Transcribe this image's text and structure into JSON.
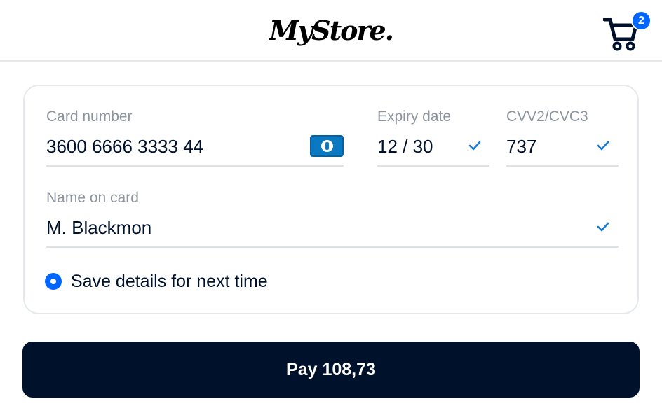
{
  "header": {
    "logo_text": "MyStore.",
    "cart_count": "2"
  },
  "form": {
    "card_number": {
      "label": "Card number",
      "value": "3600 6666 3333 44",
      "brand_icon": "diners-club-icon"
    },
    "expiry": {
      "label": "Expiry date",
      "value": "12 / 30"
    },
    "cvv": {
      "label": "CVV2/CVC3",
      "value": "737"
    },
    "name": {
      "label": "Name on card",
      "value": "M. Blackmon"
    },
    "save_details": {
      "label": "Save details for next time",
      "checked": true
    }
  },
  "pay_button": {
    "label": "Pay 108,73"
  },
  "colors": {
    "accent": "#0066ff",
    "primary_dark": "#00112c",
    "label_gray": "#8c959d",
    "border_gray": "#e6e9eb",
    "check_blue": "#1a7bd6"
  }
}
